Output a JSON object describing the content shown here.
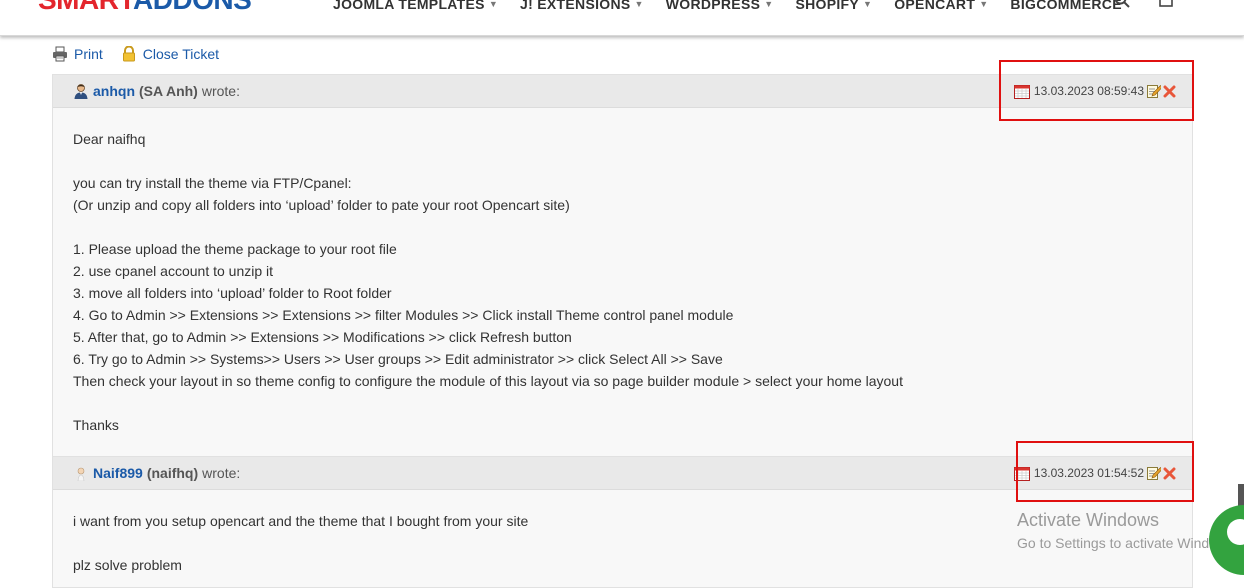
{
  "header": {
    "logo_part1": "SMART",
    "logo_part2": "ADDONS",
    "nav": [
      {
        "label": "JOOMLA TEMPLATES"
      },
      {
        "label": "J! EXTENSIONS"
      },
      {
        "label": "WORDPRESS"
      },
      {
        "label": "SHOPIFY"
      },
      {
        "label": "OPENCART"
      },
      {
        "label": "BIGCOMMERCE"
      }
    ],
    "search_icon": "search-icon",
    "cart_icon": "cart-icon"
  },
  "actions": {
    "print_label": "Print",
    "close_label": "Close Ticket"
  },
  "messages": [
    {
      "username": "anhqn",
      "nick": "(SA Anh)",
      "wrote": "wrote:",
      "timestamp": "13.03.2023 08:59:43",
      "lines": [
        "Dear naifhq",
        "",
        "you can try install the theme via FTP/Cpanel:",
        "(Or unzip and copy all folders into ‘upload’ folder to pate your root Opencart site)",
        "",
        "1. Please upload the theme package to your root file",
        "2. use cpanel account to unzip it",
        "3. move all folders into ‘upload’ folder to Root folder",
        "4. Go to Admin >> Extensions >> Extensions >> filter Modules >> Click install Theme control panel module",
        "5. After that, go to Admin >> Extensions >> Modifications >> click Refresh button",
        "6. Try go to Admin >> Systems>> Users >> User groups >> Edit administrator >> click Select All >> Save",
        "Then check your layout in so theme config to configure the module of this layout via so page builder module > select your home layout",
        "",
        "Thanks"
      ]
    },
    {
      "username": "Naif899",
      "nick": "(naifhq)",
      "wrote": "wrote:",
      "timestamp": "13.03.2023 01:54:52",
      "lines": [
        "i want from you setup opencart and the theme that I bought from your site",
        "",
        "plz solve problem"
      ]
    }
  ],
  "watermark": {
    "line1": "Activate Windows",
    "line2": "Go to Settings to activate Windows."
  },
  "colors": {
    "link": "#1b5aa8",
    "logo_red": "#e3262d",
    "highlight_box": "#e01010",
    "chat": "#33a33f"
  }
}
